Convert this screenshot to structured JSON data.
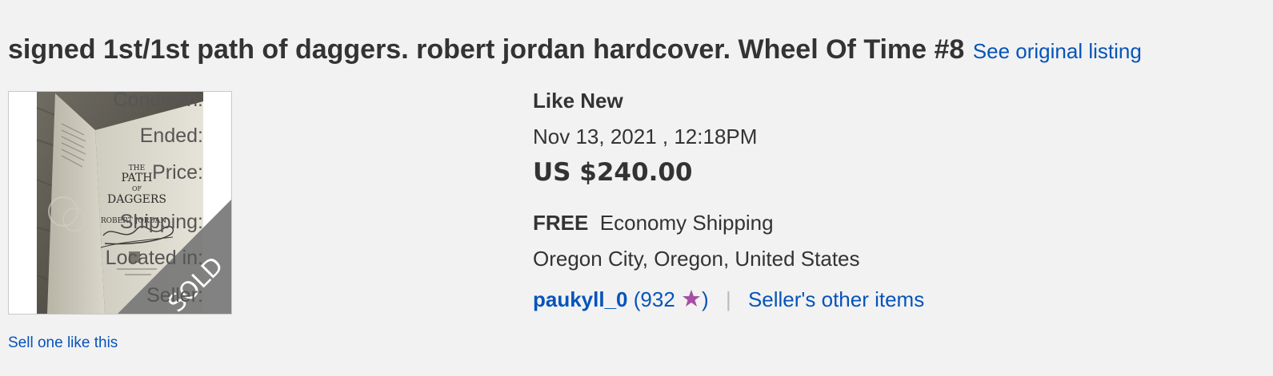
{
  "listing": {
    "title": "signed 1st/1st path of daggers. robert jordan hardcover. Wheel Of Time #8",
    "see_original": "See original listing"
  },
  "image": {
    "badge": "SOLD",
    "book_lines": [
      "THE",
      "PATH",
      "OF",
      "DAGGERS",
      "ROBERT JORDAN"
    ]
  },
  "sell_one": "Sell one like this",
  "details": {
    "condition_label": "Condition:",
    "condition_value": "Like New",
    "ended_label": "Ended:",
    "ended_value": "Nov 13, 2021 , 12:18PM",
    "price_label": "Price:",
    "price_value": "US $240.00",
    "shipping_label": "Shipping:",
    "shipping_free": "FREE",
    "shipping_method": "Economy Shipping",
    "location_label": "Located in:",
    "location_value": "Oregon City, Oregon, United States",
    "seller_label": "Seller:",
    "seller_name": "paukyll_0",
    "seller_open": "(",
    "seller_feedback": "932",
    "seller_close": ")",
    "separator": "|",
    "other_items": "Seller's other items"
  },
  "colors": {
    "link": "#0654ba",
    "star": "#a64ea6",
    "background": "#f2f2f2"
  },
  "icons": {
    "feedback_star": "purple-star-icon"
  }
}
